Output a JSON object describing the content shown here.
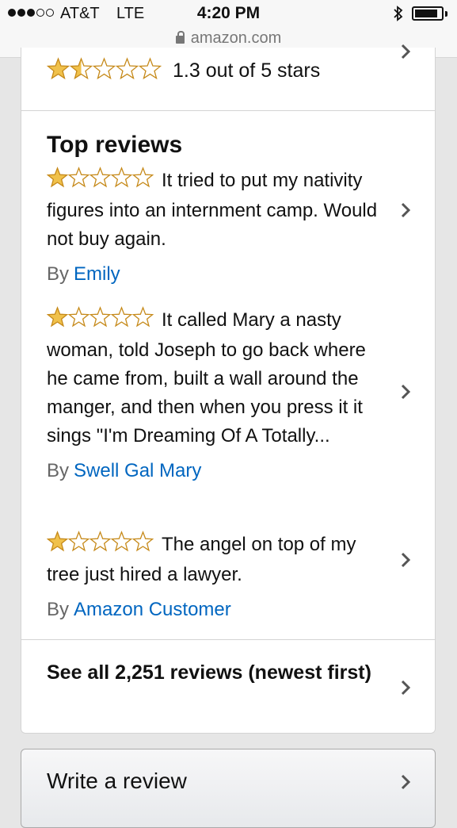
{
  "status": {
    "carrier": "AT&T",
    "network": "LTE",
    "time": "4:20 PM",
    "url": "amazon.com",
    "signal_bars": 3,
    "signal_total": 5
  },
  "summary": {
    "rating_text": "1.3 out of 5 stars",
    "stars": 1.5
  },
  "reviews_section": {
    "heading": "Top reviews",
    "by_label": "By",
    "reviews": [
      {
        "stars": 1,
        "text": "It tried to put my nativity figures into an internment camp. Would not buy again.",
        "author": "Emily"
      },
      {
        "stars": 1,
        "text": "It called Mary a nasty woman, told Joseph to go back where he came from, built a wall around the manger, and then when you press it it sings \"I'm Dreaming Of A Totally...",
        "author": "Swell Gal Mary"
      },
      {
        "stars": 1,
        "text": "The angel on top of my tree just hired a lawyer.",
        "author": "Amazon Customer"
      }
    ],
    "see_all": "See all 2,251 reviews (newest first)"
  },
  "actions": {
    "write_review": "Write a review"
  },
  "colors": {
    "star_fill": "#f0c14b",
    "star_outline": "#c68a1a",
    "link": "#0066c0"
  }
}
